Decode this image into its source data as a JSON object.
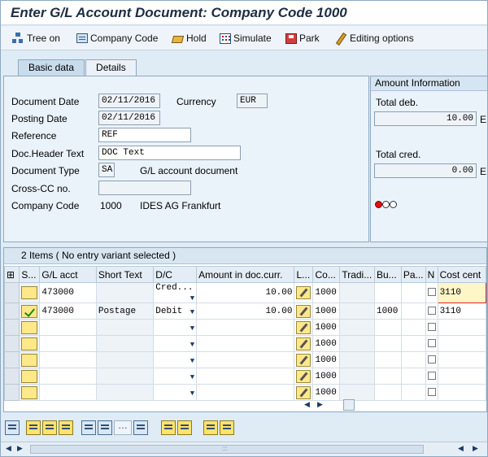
{
  "title": "Enter G/L Account Document: Company Code 1000",
  "toolbar": {
    "tree_on": "Tree on",
    "company_code": "Company Code",
    "hold": "Hold",
    "simulate": "Simulate",
    "park": "Park",
    "editing_options": "Editing options"
  },
  "tabs": [
    "Basic data",
    "Details"
  ],
  "header": {
    "document_date_label": "Document Date",
    "document_date": "02/11/2016",
    "currency_label": "Currency",
    "currency": "EUR",
    "posting_date_label": "Posting Date",
    "posting_date": "02/11/2016",
    "reference_label": "Reference",
    "reference": "REF",
    "doc_header_text_label": "Doc.Header Text",
    "doc_header_text": "DOC Text",
    "document_type_label": "Document Type",
    "document_type": "SA",
    "document_type_desc": "G/L account document",
    "cross_cc_label": "Cross-CC no.",
    "cross_cc": "",
    "company_code_label": "Company Code",
    "company_code": "1000",
    "company_name": "IDES AG Frankfurt"
  },
  "amount_info": {
    "title": "Amount Information",
    "total_deb_label": "Total deb.",
    "total_deb": "10.00",
    "total_deb_unit": "E",
    "total_cred_label": "Total cred.",
    "total_cred": "0.00",
    "total_cred_unit": "E",
    "traffic_light": "red"
  },
  "items": {
    "title": "2 Items ( No entry variant selected )",
    "columns": [
      "S...",
      "G/L acct",
      "Short Text",
      "D/C",
      "Amount in doc.curr.",
      "L...",
      "Co...",
      "Tradi...",
      "Bu...",
      "Pa...",
      "N",
      "Cost cent"
    ],
    "rows": [
      {
        "gl": "473000",
        "text": "",
        "dc": "Cred...",
        "amount": "10.00",
        "co": "1000",
        "trad": "",
        "bu": "",
        "pa": "",
        "cost": "3110"
      },
      {
        "gl": "473000",
        "text": "Postage",
        "dc": "Debit",
        "amount": "10.00",
        "co": "1000",
        "trad": "",
        "bu": "1000",
        "pa": "",
        "cost": "3110"
      },
      {
        "gl": "",
        "text": "",
        "dc": "",
        "amount": "",
        "co": "1000",
        "trad": "",
        "bu": "",
        "pa": "",
        "cost": ""
      },
      {
        "gl": "",
        "text": "",
        "dc": "",
        "amount": "",
        "co": "1000",
        "trad": "",
        "bu": "",
        "pa": "",
        "cost": ""
      },
      {
        "gl": "",
        "text": "",
        "dc": "",
        "amount": "",
        "co": "1000",
        "trad": "",
        "bu": "",
        "pa": "",
        "cost": ""
      },
      {
        "gl": "",
        "text": "",
        "dc": "",
        "amount": "",
        "co": "1000",
        "trad": "",
        "bu": "",
        "pa": "",
        "cost": ""
      },
      {
        "gl": "",
        "text": "",
        "dc": "",
        "amount": "",
        "co": "1000",
        "trad": "",
        "bu": "",
        "pa": "",
        "cost": ""
      }
    ]
  }
}
